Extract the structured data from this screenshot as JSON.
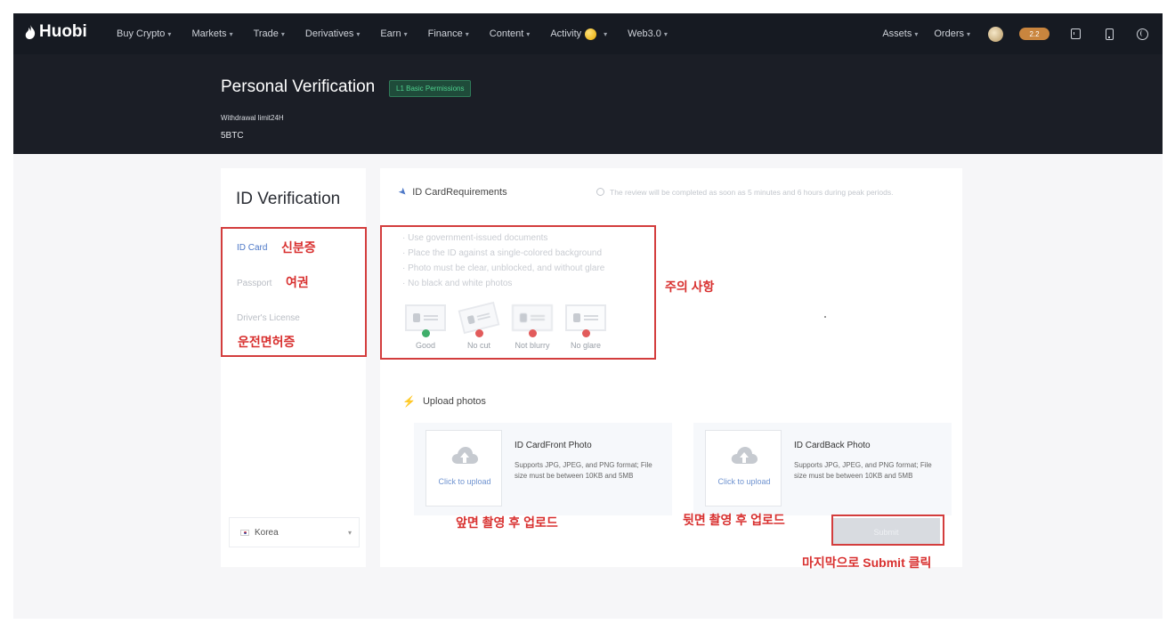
{
  "nav": {
    "logo": "Huobi",
    "items": [
      {
        "label": "Buy Crypto"
      },
      {
        "label": "Markets"
      },
      {
        "label": "Trade"
      },
      {
        "label": "Derivatives"
      },
      {
        "label": "Earn"
      },
      {
        "label": "Finance"
      },
      {
        "label": "Content"
      },
      {
        "label": "Activity"
      },
      {
        "label": "Web3.0"
      }
    ],
    "right": {
      "assets": "Assets",
      "orders": "Orders",
      "badge": "2.2"
    }
  },
  "header": {
    "title": "Personal Verification",
    "badge": "L1 Basic Permissions",
    "withdrawal_label": "Withdrawal limit24H",
    "withdrawal_value": "5BTC"
  },
  "sidebar": {
    "title": "ID Verification",
    "items": [
      {
        "label": "ID Card"
      },
      {
        "label": "Passport"
      },
      {
        "label": "Driver's License"
      }
    ],
    "country": "Korea"
  },
  "requirements": {
    "heading": "ID CardRequirements",
    "note": "The review will be completed as soon as 5 minutes and 6 hours during peak periods.",
    "list": [
      "Use government-issued documents",
      "Place the ID against a single-colored background",
      "Photo must be clear, unblocked, and without glare",
      "No black and white photos"
    ],
    "samples": [
      {
        "label": "Good"
      },
      {
        "label": "No cut"
      },
      {
        "label": "Not blurry"
      },
      {
        "label": "No glare"
      }
    ]
  },
  "upload": {
    "heading": "Upload photos",
    "front": {
      "cta": "Click to upload",
      "title": "ID CardFront Photo",
      "desc": "Supports JPG, JPEG, and PNG format; File size must be between 10KB and 5MB"
    },
    "back": {
      "cta": "Click to upload",
      "title": "ID CardBack Photo",
      "desc": "Supports JPG, JPEG, and PNG format; File size must be between 10KB and 5MB"
    },
    "submit": "Submit"
  },
  "annotations": {
    "id_card": "신분증",
    "passport": "여권",
    "license": "운전면허증",
    "caution": "주의 사항",
    "front": "앞면 촬영 후 업로드",
    "back": "뒷면 촬영 후 업로드",
    "submit": "마지막으로 Submit 클릭"
  },
  "colors": {
    "nav_bg": "#161a22",
    "header_bg": "#1b1e26",
    "accent_blue": "#4d78c7",
    "badge_green": "#4fd08e",
    "annotation_red": "#d8302f"
  }
}
